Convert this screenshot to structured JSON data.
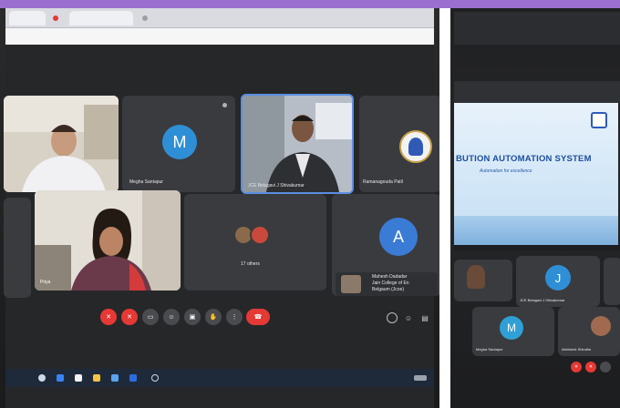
{
  "left_photo": {
    "participants": [
      {
        "name": "Megha Santapur",
        "initial": "M",
        "avatar_color": "#2f8fd6"
      },
      {
        "name": "JCE Belagavi J Shivakumar"
      },
      {
        "name": "Ramanagouda Patil"
      },
      {
        "name": "Priya"
      },
      {
        "name": "17 others"
      },
      {
        "name": "Mahesh Dadadar",
        "initial": "A",
        "avatar_color": "#3a7bd5"
      }
    ],
    "mahesh_tile_lines": [
      "Jain College of En",
      "Belgaum (Jcoe)"
    ],
    "controls_color": "#e53935"
  },
  "right_photo": {
    "slide_title": "BUTION AUTOMATION SYSTEM",
    "slide_subtitle": "Automation for excellence",
    "participants": [
      {
        "name": "JCE Belagavi J Shivakumar",
        "initial": "J",
        "avatar_color": "#2f8fd6"
      },
      {
        "name": "Megha Santapur",
        "initial": "M",
        "avatar_color": "#2fa0d6"
      },
      {
        "name": "Abhishek Shindhe"
      }
    ]
  }
}
